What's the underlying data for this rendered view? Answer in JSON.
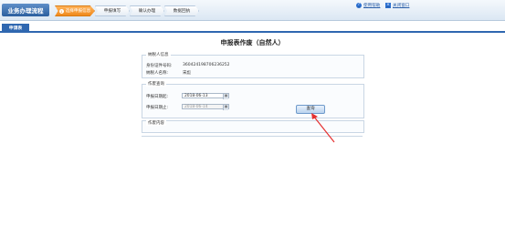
{
  "header": {
    "brand": "业务办理流程",
    "steps": [
      {
        "num": "1",
        "label": "选择申报信息"
      },
      {
        "num": "",
        "label": "申报填写"
      },
      {
        "num": "",
        "label": "确认办理"
      },
      {
        "num": "",
        "label": "数据回执"
      }
    ],
    "help_link": "使用帮助",
    "close_link": "关闭窗口"
  },
  "tabs": [
    {
      "label": "申请表"
    }
  ],
  "form": {
    "title": "申报表作废（自然人）",
    "taxpayer_section": {
      "legend": "纳税人信息",
      "id_label": "身份证件号码:",
      "id_value": "360424198706236252",
      "name_label": "纳税人名称:",
      "name_value": "宋彪"
    },
    "query_section": {
      "legend": "作废查询",
      "start_label": "申报日期起:",
      "start_value": "2018-06-13",
      "end_label": "申报日期止:",
      "end_value": "2018-06-14",
      "query_button": "查询"
    },
    "content_section": {
      "legend": "作废内容"
    }
  },
  "colors": {
    "accent": "#2f67b0",
    "active_step": "#f08a1c",
    "annotation_arrow": "#e53030"
  },
  "icons": {
    "help": "help-icon",
    "close": "close-window-icon",
    "calendar": "calendar-icon"
  }
}
